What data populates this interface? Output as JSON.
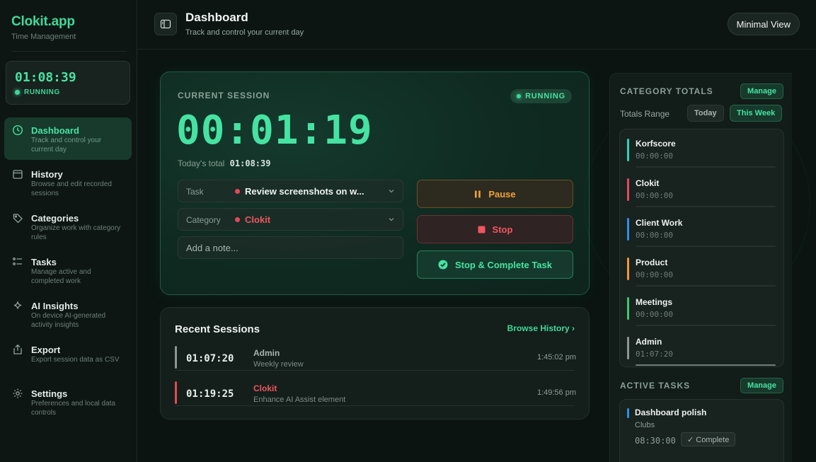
{
  "brand": {
    "name": "Clokit.app",
    "subtitle": "Time Management"
  },
  "mini_timer": {
    "time": "01:08:39",
    "status": "RUNNING"
  },
  "nav": [
    {
      "label": "Dashboard",
      "desc": "Track and control your current day",
      "icon": "clock-icon",
      "active": true
    },
    {
      "label": "History",
      "desc": "Browse and edit recorded sessions",
      "icon": "calendar-icon"
    },
    {
      "label": "Categories",
      "desc": "Organize work with category rules",
      "icon": "tag-icon"
    },
    {
      "label": "Tasks",
      "desc": "Manage active and completed work",
      "icon": "checklist-icon"
    },
    {
      "label": "AI Insights",
      "desc": "On device AI-generated activity insights",
      "icon": "sparkle-icon"
    },
    {
      "label": "Export",
      "desc": "Export session data as CSV",
      "icon": "share-icon"
    },
    {
      "label": "Settings",
      "desc": "Preferences and local data controls",
      "icon": "gear-icon"
    }
  ],
  "header": {
    "title": "Dashboard",
    "subtitle": "Track and control your current day",
    "minimal_view_label": "Minimal View"
  },
  "session": {
    "label": "CURRENT SESSION",
    "status": "RUNNING",
    "timer": "00:01:19",
    "today_total_label": "Today's total",
    "today_total": "01:08:39",
    "task_label": "Task",
    "task_value": "Review screenshots on w...",
    "category_label": "Category",
    "category_value": "Clokit",
    "note_placeholder": "Add a note...",
    "pause_label": "Pause",
    "stop_label": "Stop",
    "complete_label": "Stop & Complete Task"
  },
  "recent": {
    "title": "Recent Sessions",
    "browse_label": "Browse History ›",
    "sessions": [
      {
        "duration": "01:07:20",
        "category": "Admin",
        "task": "Weekly review",
        "time": "1:45:02 pm",
        "color": "#8e9693"
      },
      {
        "duration": "01:19:25",
        "category": "Clokit",
        "task": "Enhance AI Assist element",
        "time": "1:49:56 pm",
        "color": "#e5485b"
      }
    ]
  },
  "category_totals": {
    "title": "CATEGORY TOTALS",
    "manage_label": "Manage",
    "range_label": "Totals Range",
    "today_label": "Today",
    "week_label": "This Week",
    "items": [
      {
        "name": "Korfscore",
        "time": "00:00:00",
        "color": "#2fd3b4",
        "progress": 0
      },
      {
        "name": "Clokit",
        "time": "00:00:00",
        "color": "#e5485b",
        "progress": 0
      },
      {
        "name": "Client Work",
        "time": "00:00:00",
        "color": "#2f8fe6",
        "progress": 0
      },
      {
        "name": "Product",
        "time": "00:00:00",
        "color": "#f0953c",
        "progress": 0
      },
      {
        "name": "Meetings",
        "time": "00:00:00",
        "color": "#3fc76a",
        "progress": 0
      },
      {
        "name": "Admin",
        "time": "01:07:20",
        "color": "#8e9693",
        "progress": 1
      }
    ]
  },
  "active_tasks": {
    "title": "ACTIVE TASKS",
    "manage_label": "Manage",
    "items": [
      {
        "name": "Dashboard polish",
        "club": "Clubs",
        "time": "08:30:00",
        "complete_label": "✓ Complete"
      }
    ]
  }
}
